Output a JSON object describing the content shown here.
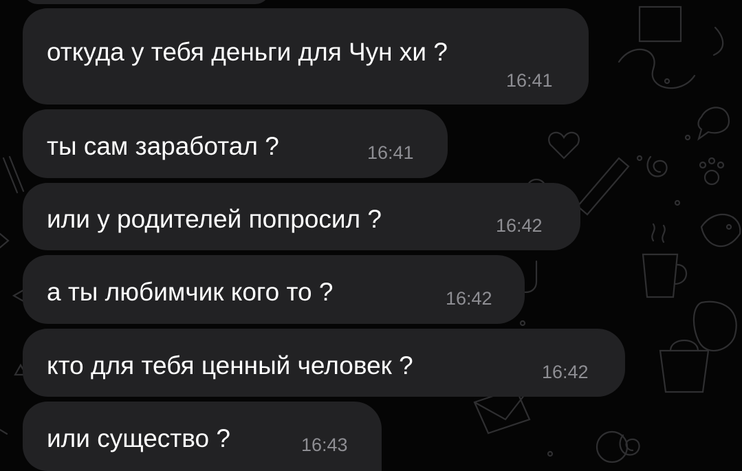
{
  "colors": {
    "background": "#050505",
    "bubble": "#222224",
    "text": "#ffffff",
    "time": "#8e8e93",
    "doodle": "#2f2f31"
  },
  "messages": [
    {
      "text": "откуда у тебя деньги для Чун хи ?",
      "time": "16:41"
    },
    {
      "text": "ты сам заработал ?",
      "time": "16:41"
    },
    {
      "text": "или у родителей попросил ?",
      "time": "16:42"
    },
    {
      "text": "а ты любимчик кого то ?",
      "time": "16:42"
    },
    {
      "text": "кто для тебя ценный человек ?",
      "time": "16:42"
    },
    {
      "text": "или существо ?",
      "time": "16:43"
    }
  ]
}
